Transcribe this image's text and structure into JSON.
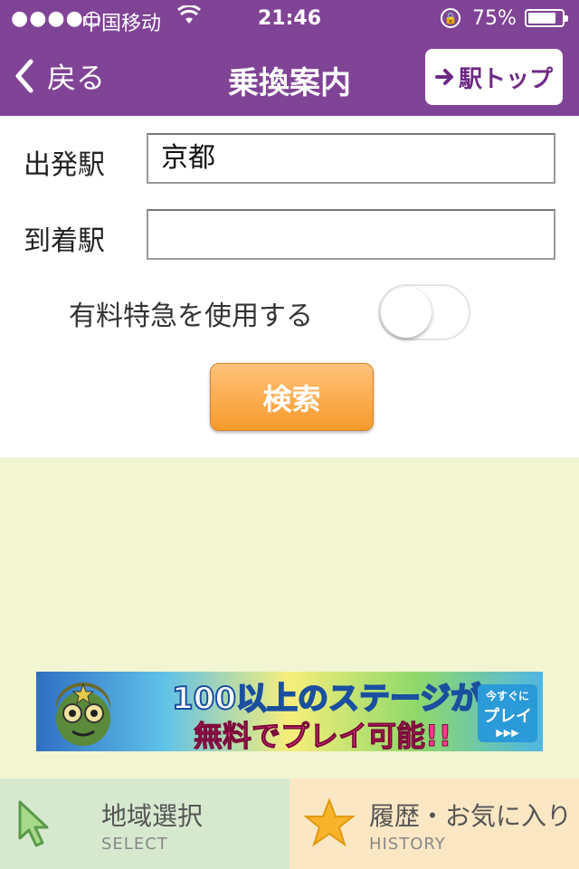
{
  "status_bar": {
    "signal": "●●●●○",
    "carrier": "中国移动",
    "time": "21:46",
    "battery_pct": "75%"
  },
  "nav": {
    "back_label": "戻る",
    "title": "乗換案内",
    "top_button_label": "駅トップ"
  },
  "form": {
    "departure_label": "出発駅",
    "departure_value": "京都",
    "arrival_label": "到着駅",
    "arrival_value": "",
    "express_toggle_label": "有料特急を使用する",
    "express_toggle_on": false,
    "search_label": "検索"
  },
  "ad": {
    "line1": "100以上のステージが",
    "line2": "無料でプレイ可能!!",
    "cta_top": "今すぐに",
    "cta_main": "プレイ",
    "cta_arrows": "▶▶▶"
  },
  "tabs": [
    {
      "label": "地域選択",
      "sub": "SELECT",
      "icon": "cursor-arrow-icon"
    },
    {
      "label": "履歴・お気に入り",
      "sub": "HISTORY",
      "icon": "star-icon"
    }
  ],
  "colors": {
    "nav_bg": "#804496",
    "search_button": "#f79a2a",
    "content_bg": "#f2f5d2"
  }
}
